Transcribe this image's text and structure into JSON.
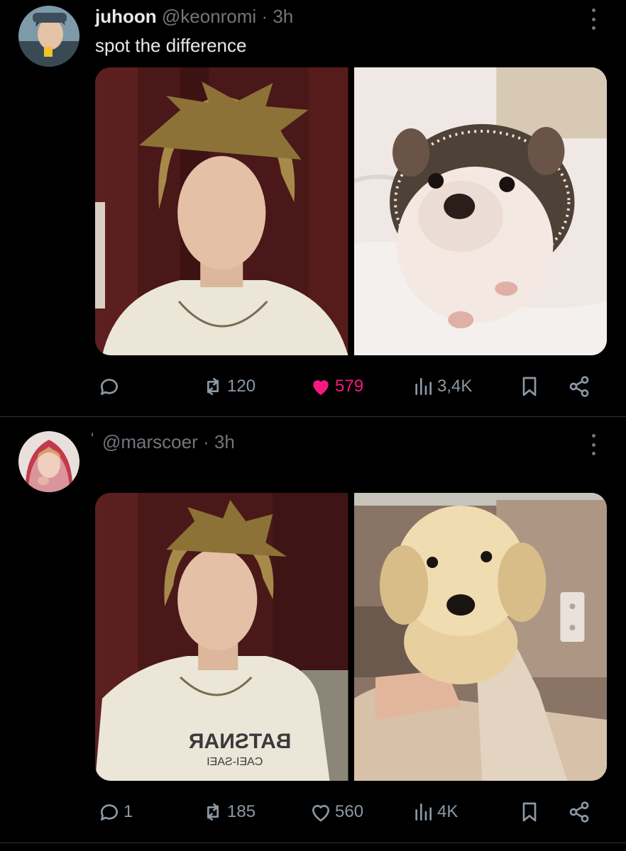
{
  "tweets": [
    {
      "name": "juhoon",
      "handle": "@keonromi",
      "separator": "·",
      "time": "3h",
      "text": "spot the difference",
      "media": [
        {
          "subject": "person with spiky blonde hair in white t-shirt"
        },
        {
          "subject": "hedgehog on white blanket"
        }
      ],
      "actions": {
        "replies": "",
        "retweets": "120",
        "likes": "579",
        "views": "3,4K",
        "liked": true
      }
    },
    {
      "name": "",
      "handle": "@marscoer",
      "separator": "·",
      "time": "3h",
      "text": "",
      "media": [
        {
          "subject": "person with spiky blonde hair in graphic t-shirt"
        },
        {
          "subject": "golden retriever puppy in towel"
        }
      ],
      "actions": {
        "replies": "1",
        "retweets": "185",
        "likes": "560",
        "views": "4K",
        "liked": false
      }
    }
  ],
  "colors": {
    "background": "#000000",
    "text_primary": "#e7e9ea",
    "text_secondary": "#71767b",
    "action_gray": "#8b98a5",
    "like_pink": "#f91880",
    "divider": "#2f3336"
  },
  "icons": {
    "reply": "speech-bubble-icon",
    "retweet": "retweet-arrows-icon",
    "like": "heart-icon",
    "views": "bar-chart-icon",
    "bookmark": "bookmark-icon",
    "share": "share-nodes-icon",
    "more": "vertical-ellipsis-icon"
  }
}
